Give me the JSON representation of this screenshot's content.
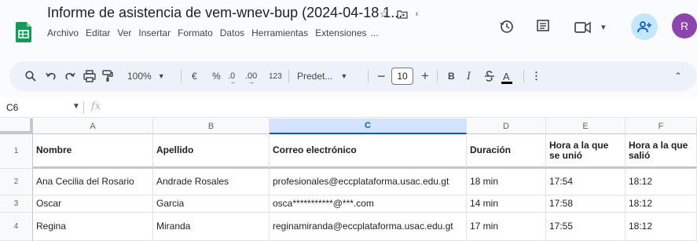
{
  "title": "Informe de asistencia de vem-wnev-bup (2024-04-18 1...",
  "menu": [
    "Archivo",
    "Editar",
    "Ver",
    "Insertar",
    "Formato",
    "Datos",
    "Herramientas",
    "Extensiones",
    "..."
  ],
  "avatar_letter": "R",
  "toolbar": {
    "zoom": "100%",
    "currency": "€",
    "percent": "%",
    "dec_decrease": ".0",
    "dec_increase": ".00",
    "number_format": "123",
    "font": "Predet...",
    "font_size": "10",
    "bold": "B",
    "italic": "I",
    "text_color": "A"
  },
  "formula_bar": {
    "cell_ref": "C6",
    "fx": "fx"
  },
  "columns": [
    "A",
    "B",
    "C",
    "D",
    "E",
    "F"
  ],
  "rows": [
    "1",
    "2",
    "3",
    "4"
  ],
  "table": [
    [
      "Nombre",
      "Apellido",
      "Correo electrónico",
      "Duración",
      "Hora a la que se unió",
      "Hora a la que salió"
    ],
    [
      "Ana Cecilia del Rosario",
      "Andrade Rosales",
      "profesionales@eccplataforma.usac.edu.gt",
      "18 min",
      "17:54",
      "18:12"
    ],
    [
      "Oscar",
      "Garcia",
      "osca***********@***.com",
      "14 min",
      "17:58",
      "18:12"
    ],
    [
      "Regina",
      "Miranda",
      "reginamiranda@eccplataforma.usac.edu.gt",
      "17 min",
      "17:55",
      "18:12"
    ]
  ],
  "colors": {
    "selected_column_bg": "#d3e3fd",
    "accent": "#0b57d0",
    "share_bg": "#c2e7ff",
    "avatar_bg": "#8e44ad"
  }
}
